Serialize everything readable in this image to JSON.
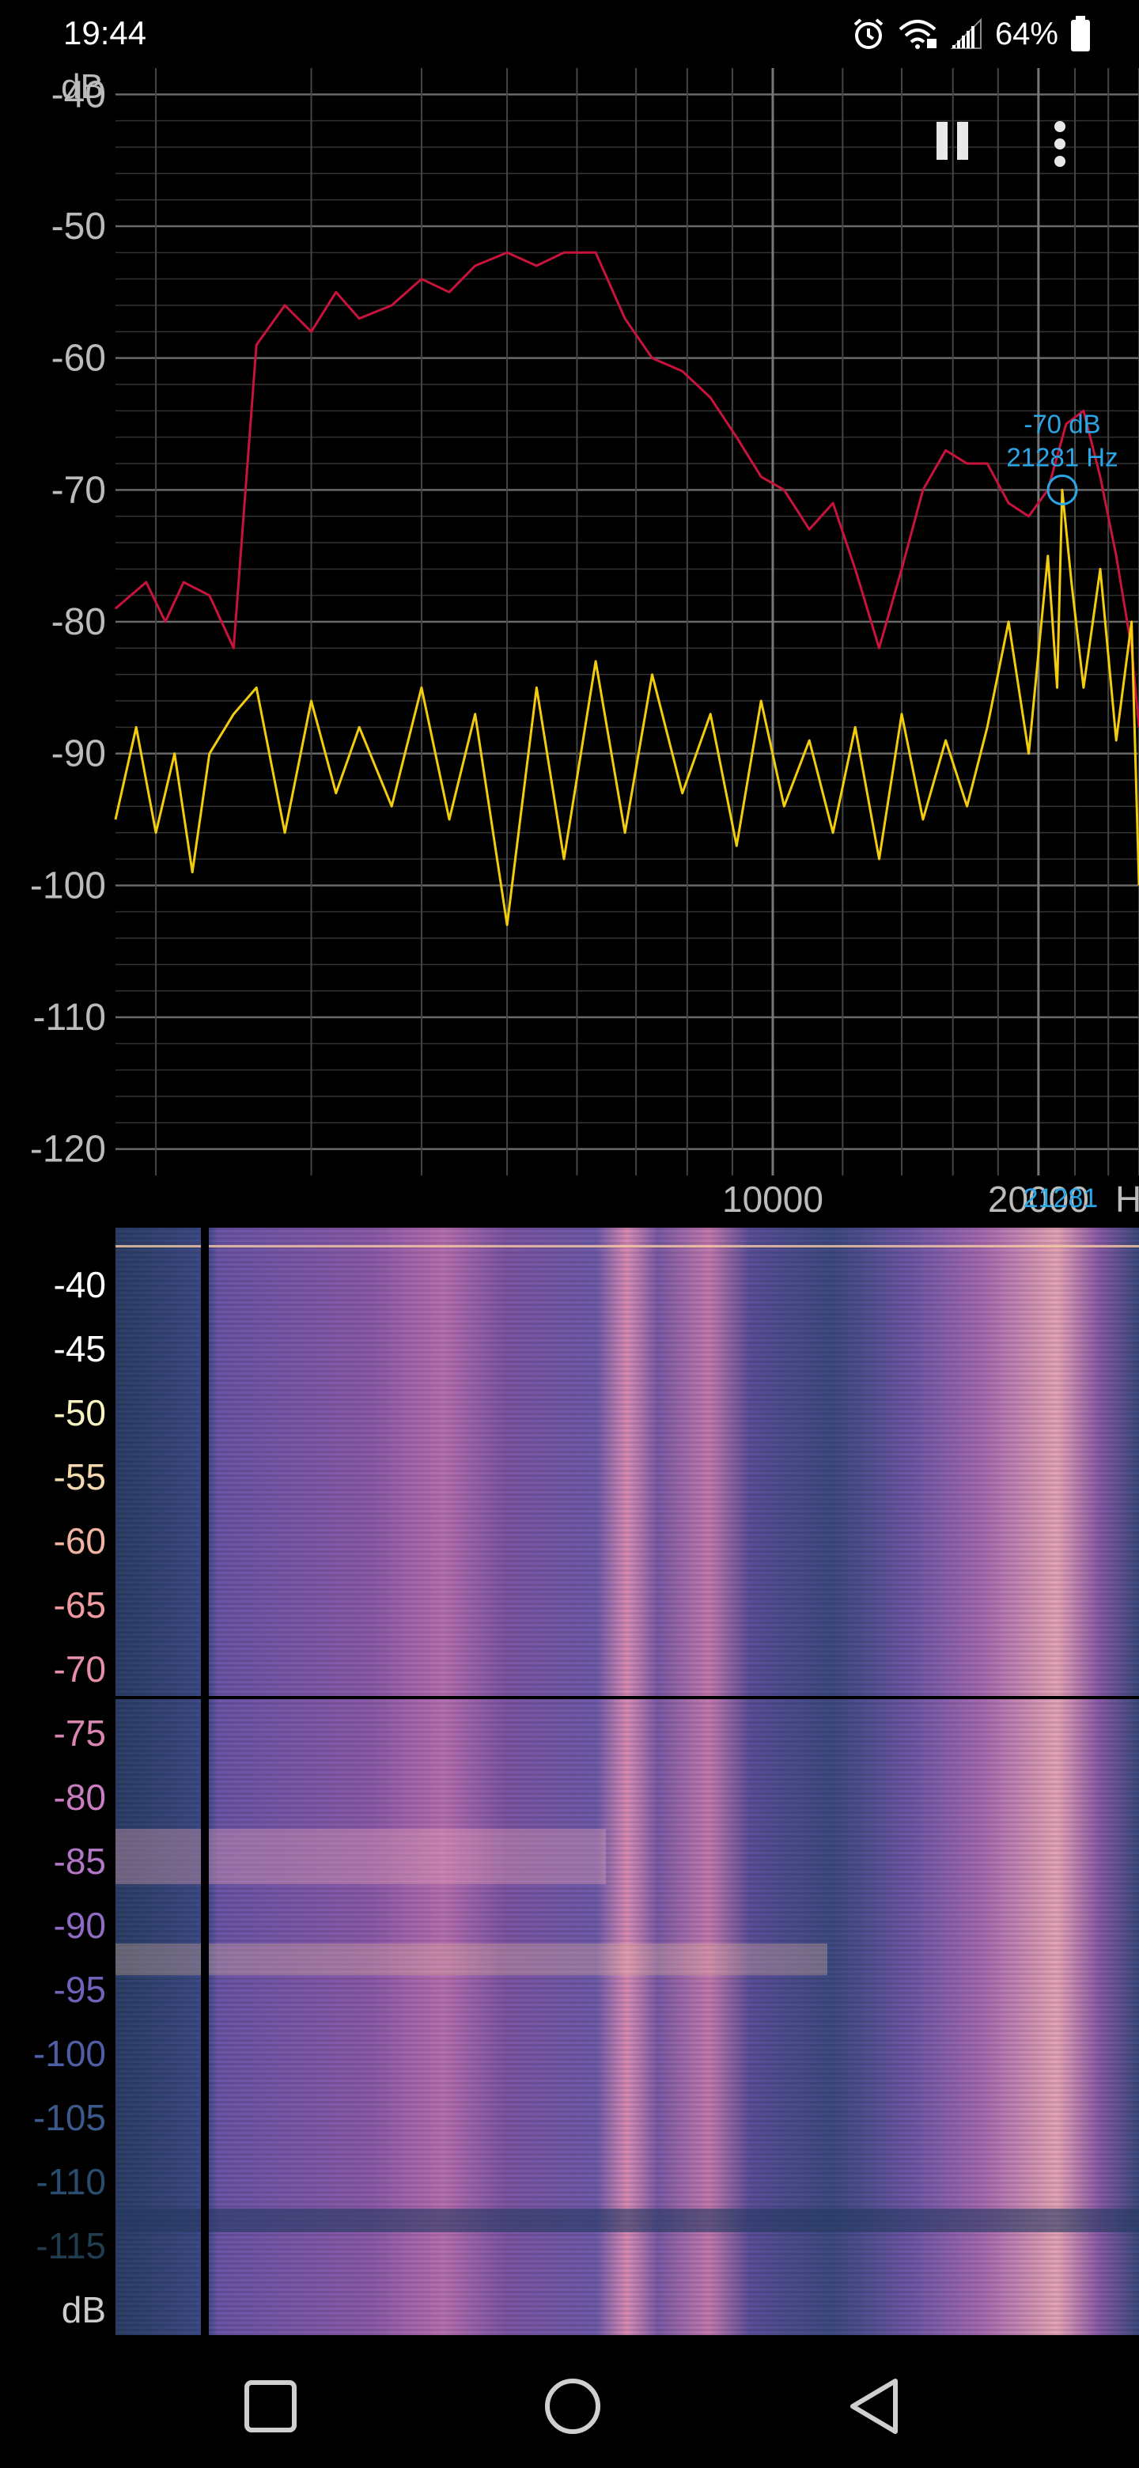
{
  "status_bar": {
    "time": "19:44",
    "battery": "64%",
    "icons": [
      "alarm-icon",
      "wifi-icon",
      "signal-icon",
      "battery-icon"
    ]
  },
  "toolbar": {
    "pause_icon": "pause-icon",
    "menu_icon": "more-vert-icon"
  },
  "spectrum": {
    "y_unit": "dB",
    "x_unit": "Hz",
    "y_ticks": [
      "-40",
      "-50",
      "-60",
      "-70",
      "-80",
      "-90",
      "-100",
      "-110",
      "-120"
    ],
    "x_tick_labels": [
      "10000",
      "20000"
    ],
    "cursor": {
      "db": "-70 dB",
      "hz": "21281 Hz",
      "axis_label": "21281"
    },
    "colors": {
      "peak_hold": "#c8133d",
      "live": "#f2cc0d",
      "cursor": "#2aa6e6",
      "grid": "#555555"
    }
  },
  "chart_data": {
    "type": "line",
    "title": "",
    "xlabel": "Hz",
    "ylabel": "dB",
    "xscale": "log",
    "xlim": [
      1800,
      26000
    ],
    "ylim": [
      -122,
      -38
    ],
    "series": [
      {
        "color": "#c8133d",
        "x": [
          1800,
          1950,
          2050,
          2150,
          2300,
          2450,
          2600,
          2800,
          3000,
          3200,
          3400,
          3700,
          4000,
          4300,
          4600,
          5000,
          5400,
          5800,
          6300,
          6800,
          7300,
          7900,
          8500,
          9100,
          9700,
          10300,
          11000,
          11700,
          12400,
          13200,
          14000,
          14800,
          15700,
          16600,
          17500,
          18500,
          19500,
          20500,
          21500,
          22500,
          23500,
          24500,
          25500,
          26000
        ],
        "values": [
          -79,
          -77,
          -80,
          -77,
          -78,
          -82,
          -59,
          -56,
          -58,
          -55,
          -57,
          -56,
          -54,
          -55,
          -53,
          -52,
          -53,
          -52,
          -52,
          -57,
          -60,
          -61,
          -63,
          -66,
          -69,
          -70,
          -73,
          -71,
          -76,
          -82,
          -76,
          -70,
          -67,
          -68,
          -68,
          -71,
          -72,
          -70,
          -65,
          -64,
          -69,
          -75,
          -82,
          -88
        ]
      },
      {
        "color": "#f2cc0d",
        "x": [
          1800,
          1900,
          2000,
          2100,
          2200,
          2300,
          2450,
          2600,
          2800,
          3000,
          3200,
          3400,
          3700,
          4000,
          4300,
          4600,
          5000,
          5400,
          5800,
          6300,
          6800,
          7300,
          7900,
          8500,
          9100,
          9700,
          10300,
          11000,
          11700,
          12400,
          13200,
          14000,
          14800,
          15700,
          16600,
          17500,
          18500,
          19500,
          20500,
          21000,
          21281,
          21800,
          22500,
          23500,
          24500,
          25500,
          26000
        ],
        "values": [
          -95,
          -88,
          -96,
          -90,
          -99,
          -90,
          -87,
          -85,
          -96,
          -86,
          -93,
          -88,
          -94,
          -85,
          -95,
          -87,
          -103,
          -85,
          -98,
          -83,
          -96,
          -84,
          -93,
          -87,
          -97,
          -86,
          -94,
          -89,
          -96,
          -88,
          -98,
          -87,
          -95,
          -89,
          -94,
          -88,
          -80,
          -90,
          -75,
          -85,
          -70,
          -77,
          -85,
          -76,
          -89,
          -80,
          -100
        ]
      }
    ]
  },
  "spectrogram": {
    "scale_labels": [
      "-40",
      "-45",
      "-50",
      "-55",
      "-60",
      "-65",
      "-70",
      "-75",
      "-80",
      "-85",
      "-90",
      "-95",
      "-100",
      "-105",
      "-110",
      "-115",
      "dB"
    ],
    "scale_colors": [
      "#ffffff",
      "#ffffff",
      "#f7f3c0",
      "#f5d8b0",
      "#f2b3a1",
      "#ef9a9e",
      "#e58ea6",
      "#d985b0",
      "#c97dc0",
      "#b276c6",
      "#8f6bc4",
      "#6f63b9",
      "#4e5ea6",
      "#3b598c",
      "#2a4d6d",
      "#1f3d4f",
      "#cccccc"
    ]
  },
  "nav_bar": {
    "recents_icon": "recents-icon",
    "home_icon": "home-icon",
    "back_icon": "back-icon"
  }
}
